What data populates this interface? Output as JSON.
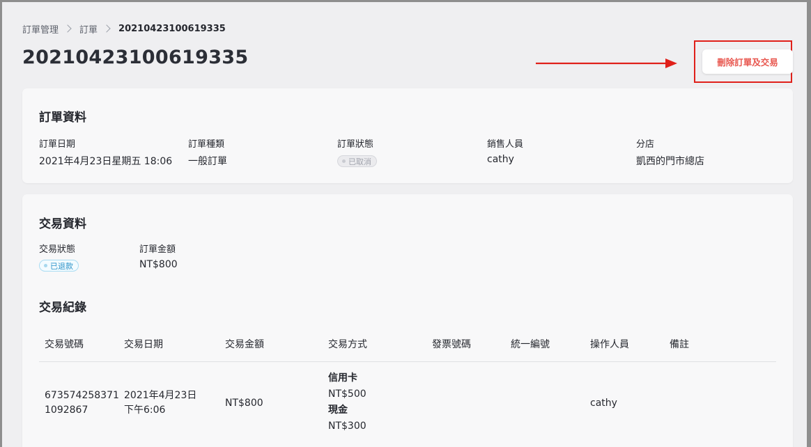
{
  "breadcrumb": {
    "items": [
      "訂單管理",
      "訂單"
    ],
    "current": "20210423100619335"
  },
  "page": {
    "title": "20210423100619335",
    "delete_button_label": "刪除訂單及交易"
  },
  "order_info": {
    "title": "訂單資料",
    "fields": {
      "date": {
        "label": "訂單日期",
        "value": "2021年4月23日星期五 18:06"
      },
      "type": {
        "label": "訂單種類",
        "value": "一般訂單"
      },
      "status": {
        "label": "訂單狀態",
        "value": "已取消"
      },
      "sales": {
        "label": "銷售人員",
        "value": "cathy"
      },
      "branch": {
        "label": "分店",
        "value": "凱西的門市總店"
      }
    }
  },
  "transaction_info": {
    "title": "交易資料",
    "status": {
      "label": "交易狀態",
      "value": "已退款"
    },
    "amount": {
      "label": "訂單金額",
      "value": "NT$800"
    }
  },
  "transaction_records": {
    "title": "交易紀錄",
    "columns": [
      "交易號碼",
      "交易日期",
      "交易金額",
      "交易方式",
      "發票號碼",
      "統一編號",
      "操作人員",
      "備註"
    ],
    "rows": [
      {
        "txn_no_line1": "673574258371",
        "txn_no_line2": "1092867",
        "date_line1": "2021年4月23日",
        "date_line2": "下午6:06",
        "amount": "NT$800",
        "methods": [
          {
            "name": "信用卡",
            "amount": "NT$500"
          },
          {
            "name": "現金",
            "amount": "NT$300"
          }
        ],
        "invoice_no": "",
        "tax_id": "",
        "operator": "cathy",
        "note": ""
      }
    ]
  },
  "colors": {
    "danger": "#e8574f",
    "annotation_red": "#e0201a",
    "refunded_badge": "#2e94c9",
    "cancelled_badge": "#a1a4ad"
  }
}
